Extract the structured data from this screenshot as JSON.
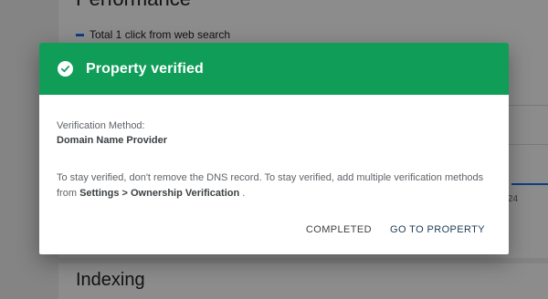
{
  "background": {
    "performance_title": "Performance",
    "legend_label": "Total 1 click from web search",
    "axis_tick": "24",
    "indexing_title": "Indexing"
  },
  "dialog": {
    "title": "Property verified",
    "method_label": "Verification Method:",
    "method_value": "Domain Name Provider",
    "message_part1": "To stay verified, don't remove the DNS record. To stay verified, add multiple verification methods from ",
    "message_link": "Settings > Ownership Verification",
    "message_part2": " .",
    "buttons": {
      "completed": "COMPLETED",
      "go_to_property": "GO TO PROPERTY"
    },
    "header_color": "#0f9d58",
    "icon": "check-circle-icon"
  }
}
